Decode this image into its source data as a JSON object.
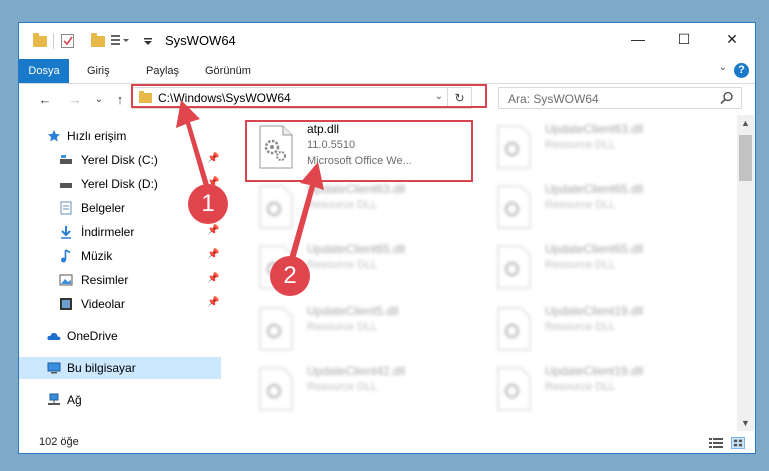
{
  "window": {
    "title": "SysWOW64",
    "minimize_glyph": "—",
    "maximize_glyph": "☐",
    "close_glyph": "✕"
  },
  "ribbon": {
    "tabs": [
      "Dosya",
      "Giriş",
      "Paylaş",
      "Görünüm"
    ],
    "collapse_glyph": "⌄",
    "help_glyph": "?"
  },
  "nav": {
    "back_glyph": "←",
    "forward_glyph": "→",
    "recent_glyph": "⌄",
    "up_glyph": "↑",
    "address": "C:\\Windows\\SysWOW64",
    "address_dropdown_glyph": "⌄",
    "refresh_glyph": "↻",
    "search_placeholder": "Ara: SysWOW64"
  },
  "sidebar": {
    "items": [
      {
        "label": "Hızlı erişim",
        "icon": "star-icon",
        "pinned": false
      },
      {
        "label": "Yerel Disk (C:)",
        "icon": "drive-icon",
        "pinned": true
      },
      {
        "label": "Yerel Disk (D:)",
        "icon": "drive-icon",
        "pinned": true
      },
      {
        "label": "Belgeler",
        "icon": "document-icon",
        "pinned": true
      },
      {
        "label": "İndirmeler",
        "icon": "download-icon",
        "pinned": true
      },
      {
        "label": "Müzik",
        "icon": "music-icon",
        "pinned": true
      },
      {
        "label": "Resimler",
        "icon": "pictures-icon",
        "pinned": true
      },
      {
        "label": "Videolar",
        "icon": "video-icon",
        "pinned": true
      },
      {
        "label": "OneDrive",
        "icon": "cloud-icon",
        "pinned": false
      },
      {
        "label": "Bu bilgisayar",
        "icon": "computer-icon",
        "pinned": false
      },
      {
        "label": "Ağ",
        "icon": "network-icon",
        "pinned": false
      }
    ],
    "pin_glyph": "📌"
  },
  "files": [
    {
      "name": "atp.dll",
      "version": "11.0.5510",
      "desc": "Microsoft Office We...",
      "clear": true
    },
    {
      "name": "UpdateClient63.dll",
      "version": "Resource DLL",
      "desc": "",
      "clear": false
    },
    {
      "name": "UpdateClient63.dll",
      "version": "Resource DLL",
      "desc": "",
      "clear": false
    },
    {
      "name": "UpdateClient65.dll",
      "version": "Resource DLL",
      "desc": "",
      "clear": false
    },
    {
      "name": "UpdateClient65.dll",
      "version": "Resource DLL",
      "desc": "",
      "clear": false
    },
    {
      "name": "UpdateClient65.dll",
      "version": "Resource DLL",
      "desc": "",
      "clear": false
    },
    {
      "name": "UpdateClient5.dll",
      "version": "Resource DLL",
      "desc": "",
      "clear": false
    },
    {
      "name": "UpdateClient19.dll",
      "version": "Resource DLL",
      "desc": "",
      "clear": false
    },
    {
      "name": "UpdateClient42.dll",
      "version": "Resource DLL",
      "desc": "",
      "clear": false
    },
    {
      "name": "UpdateClient19.dll",
      "version": "Resource DLL",
      "desc": "",
      "clear": false
    }
  ],
  "status": {
    "item_count": "102 öğe"
  },
  "annotations": {
    "step1": "1",
    "step2": "2",
    "color": "#e0444c"
  },
  "scroll": {
    "up_glyph": "▲",
    "down_glyph": "▼"
  }
}
